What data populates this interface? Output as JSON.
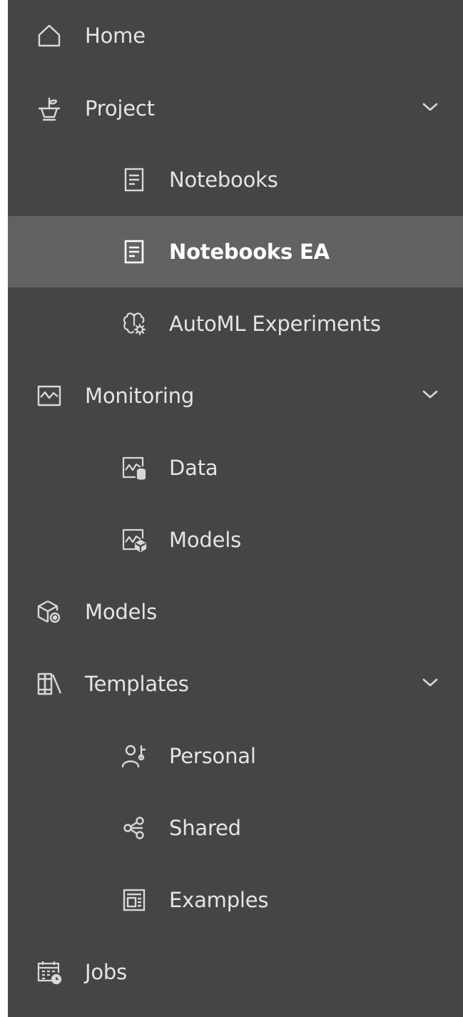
{
  "nav": {
    "items": [
      {
        "label": "Home",
        "icon": "home-icon",
        "level": 0,
        "expandable": false
      },
      {
        "label": "Project",
        "icon": "plant-icon",
        "level": 0,
        "expandable": true
      },
      {
        "label": "Notebooks",
        "icon": "notebook-icon",
        "level": 1,
        "expandable": false
      },
      {
        "label": "Notebooks EA",
        "icon": "notebook-icon",
        "level": 1,
        "expandable": false,
        "selected": true
      },
      {
        "label": "AutoML Experiments",
        "icon": "brain-gear-icon",
        "level": 1,
        "expandable": false
      },
      {
        "label": "Monitoring",
        "icon": "chart-icon",
        "level": 0,
        "expandable": true
      },
      {
        "label": "Data",
        "icon": "chart-database-icon",
        "level": 1,
        "expandable": false
      },
      {
        "label": "Models",
        "icon": "chart-cube-icon",
        "level": 1,
        "expandable": false
      },
      {
        "label": "Models",
        "icon": "cube-icon",
        "level": 0,
        "expandable": false
      },
      {
        "label": "Templates",
        "icon": "library-icon",
        "level": 0,
        "expandable": true
      },
      {
        "label": "Personal",
        "icon": "person-icon",
        "level": 1,
        "expandable": false
      },
      {
        "label": "Shared",
        "icon": "share-icon",
        "level": 1,
        "expandable": false
      },
      {
        "label": "Examples",
        "icon": "layout-icon",
        "level": 1,
        "expandable": false
      },
      {
        "label": "Jobs",
        "icon": "calendar-clock-icon",
        "level": 0,
        "expandable": false
      }
    ]
  },
  "colors": {
    "background": "#454545",
    "selected": "#626262",
    "text": "#e4e4e4"
  }
}
